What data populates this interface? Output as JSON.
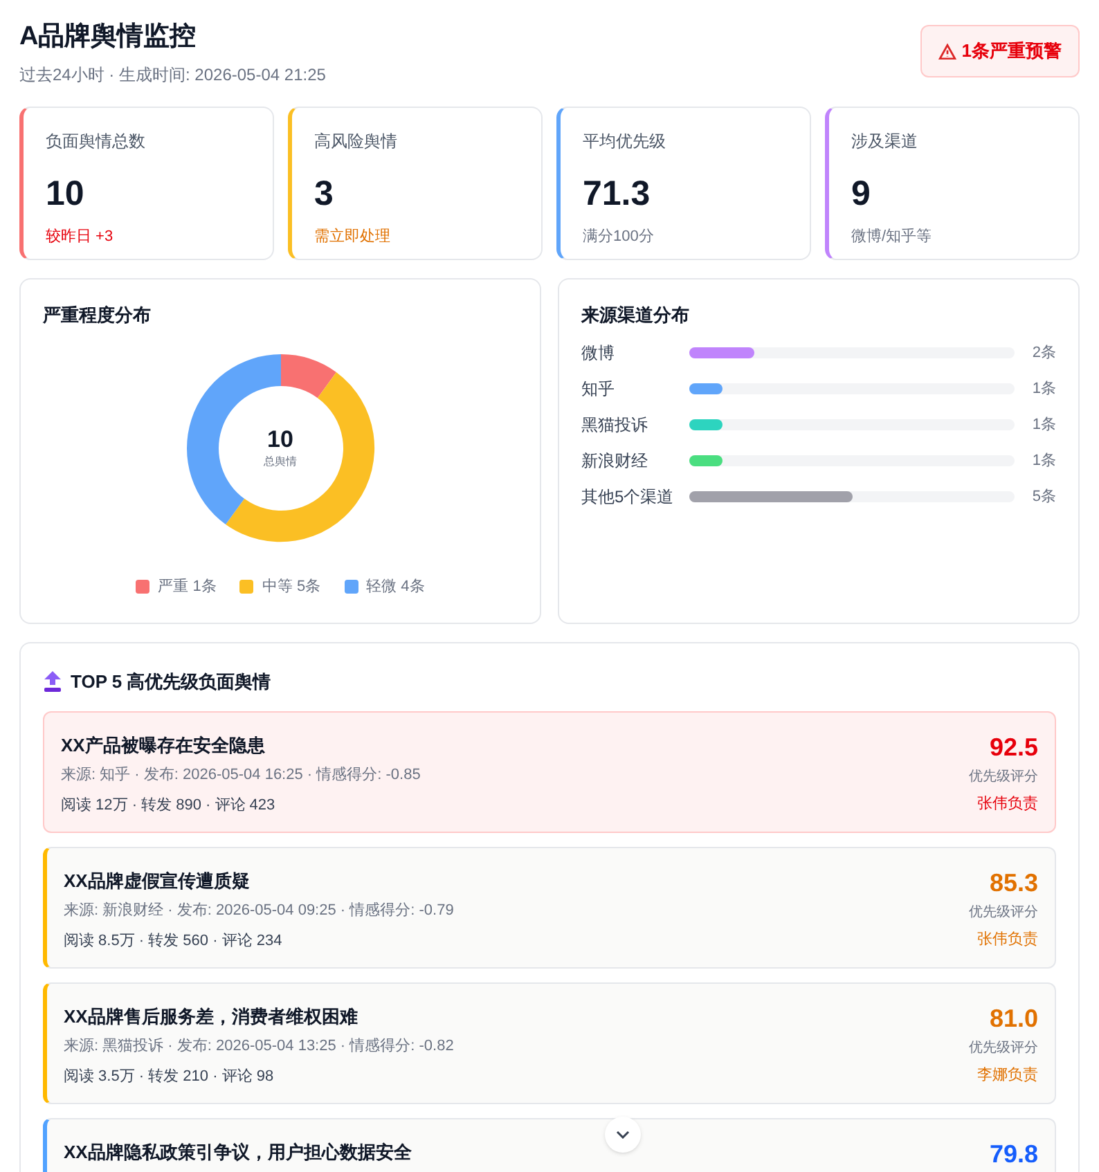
{
  "header": {
    "title": "A品牌舆情监控",
    "subtitle": "过去24小时 · 生成时间: 2026-05-04 21:25",
    "alert": "1条严重预警"
  },
  "stats": [
    {
      "label": "负面舆情总数",
      "value": "10",
      "note": "较昨日 +3",
      "color": "#f87171",
      "kind": "danger"
    },
    {
      "label": "高风险舆情",
      "value": "3",
      "note": "需立即处理",
      "color": "#fbbf24",
      "kind": "warning"
    },
    {
      "label": "平均优先级",
      "value": "71.3",
      "note": "满分100分",
      "color": "#60a5fa",
      "kind": "normal"
    },
    {
      "label": "涉及渠道",
      "value": "9",
      "note": "微博/知乎等",
      "color": "#c084fc",
      "kind": "normal"
    }
  ],
  "severity": {
    "title": "严重程度分布",
    "center_value": "10",
    "center_label": "总舆情",
    "chart_data": {
      "type": "donut",
      "values": [
        10,
        50,
        40
      ]
    },
    "legend": [
      {
        "label": "严重 1条",
        "color": "#f87171"
      },
      {
        "label": "中等 5条",
        "color": "#fbbf24"
      },
      {
        "label": "轻微 4条",
        "color": "#60a5fa"
      }
    ]
  },
  "channels": {
    "title": "来源渠道分布",
    "items": [
      {
        "name": "微博",
        "count": "2条",
        "level": 0.2,
        "color": "#c084fc"
      },
      {
        "name": "知乎",
        "count": "1条",
        "level": 0.1,
        "color": "#60a5fa"
      },
      {
        "name": "黑猫投诉",
        "count": "1条",
        "level": 0.1,
        "color": "#2dd4bf"
      },
      {
        "name": "新浪财经",
        "count": "1条",
        "level": 0.1,
        "color": "#4ade80"
      },
      {
        "name": "其他5个渠道",
        "count": "5条",
        "level": 0.5,
        "color": "#a1a1aa"
      }
    ]
  },
  "top": {
    "title": "TOP 5 高优先级负面舆情",
    "items": [
      {
        "kind": "severe",
        "title": "XX产品被曝存在安全隐患",
        "meta": "来源: 知乎 · 发布: 2026-05-04 16:25 · 情感得分: -0.85",
        "stats": "阅读 12万 · 转发 890 · 评论 423",
        "score": "92.5",
        "score_label": "优先级评分",
        "owner": "张伟负责"
      },
      {
        "kind": "medium",
        "title": "XX品牌虚假宣传遭质疑",
        "meta": "来源: 新浪财经 · 发布: 2026-05-04 09:25 · 情感得分: -0.79",
        "stats": "阅读 8.5万 · 转发 560 · 评论 234",
        "score": "85.3",
        "score_label": "优先级评分",
        "owner": "张伟负责"
      },
      {
        "kind": "medium",
        "title": "XX品牌售后服务差，消费者维权困难",
        "meta": "来源: 黑猫投诉 · 发布: 2026-05-04 13:25 · 情感得分: -0.82",
        "stats": "阅读 3.5万 · 转发 210 · 评论 98",
        "score": "81.0",
        "score_label": "优先级评分",
        "owner": "李娜负责"
      },
      {
        "kind": "minor",
        "title": "XX品牌隐私政策引争议，用户担心数据安全",
        "score": "79.8"
      }
    ]
  }
}
